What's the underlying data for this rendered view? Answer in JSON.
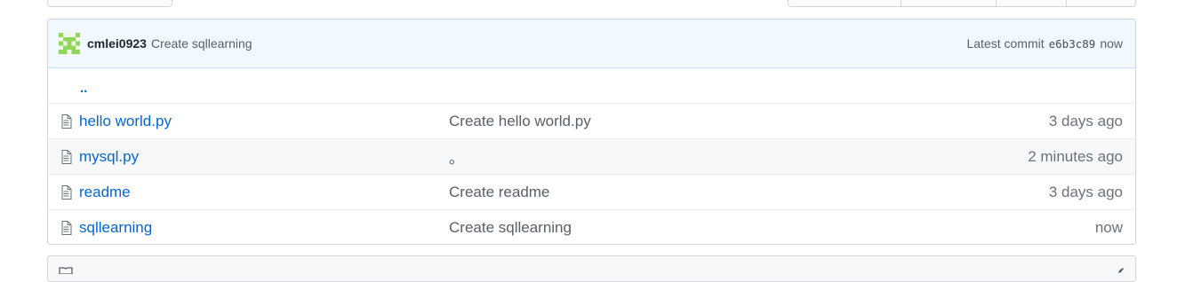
{
  "commit_tease": {
    "author": "cmlei0923",
    "message": "Create sqllearning",
    "latest_commit_label": "Latest commit",
    "sha": "e6b3c89",
    "time": "now"
  },
  "up_directory": "..",
  "files": [
    {
      "name": "hello world.py",
      "message": "Create hello world.py",
      "age": "3 days ago"
    },
    {
      "name": "mysql.py",
      "message": "。",
      "age": "2 minutes ago"
    },
    {
      "name": "readme",
      "message": "Create readme",
      "age": "3 days ago"
    },
    {
      "name": "sqllearning",
      "message": "Create sqllearning",
      "age": "now"
    }
  ],
  "colors": {
    "link": "#0366d6",
    "commit_bg": "#f1f8ff",
    "avatar": "#8fd65a"
  },
  "icons": {
    "file": "file-icon",
    "avatar": "identicon-avatar",
    "readme": "book-icon"
  }
}
